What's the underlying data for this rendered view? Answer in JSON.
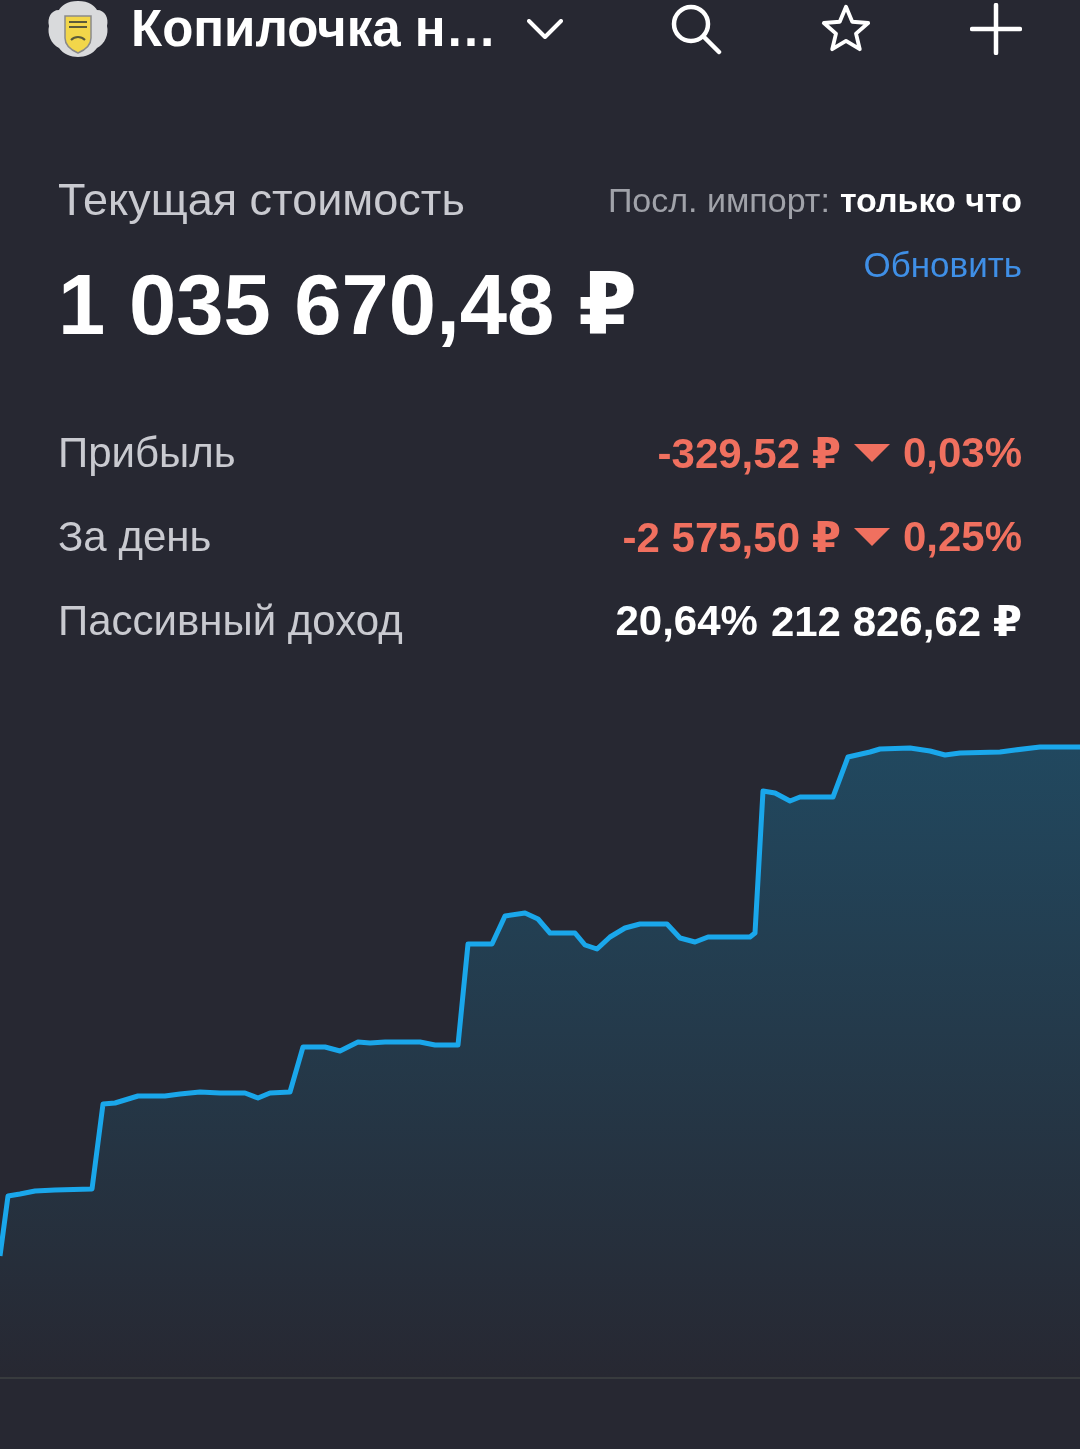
{
  "top_bar": {
    "title": "Копилочка н…"
  },
  "summary": {
    "label": "Текущая стоимость",
    "import_label": "Посл. импорт:",
    "import_value": "только что",
    "refresh": "Обновить",
    "total": "1 035 670,48 ₽"
  },
  "rows": [
    {
      "kind": "change",
      "label": "Прибыль",
      "amount": "-329,52 ₽",
      "falling": true,
      "percent": "0,03%"
    },
    {
      "kind": "change",
      "label": "За день",
      "amount": "-2 575,50 ₽",
      "falling": true,
      "percent": "0,25%"
    },
    {
      "kind": "income",
      "label": "Пассивный доход",
      "percent": "20,64%",
      "amount": "212 826,62 ₽"
    }
  ]
}
